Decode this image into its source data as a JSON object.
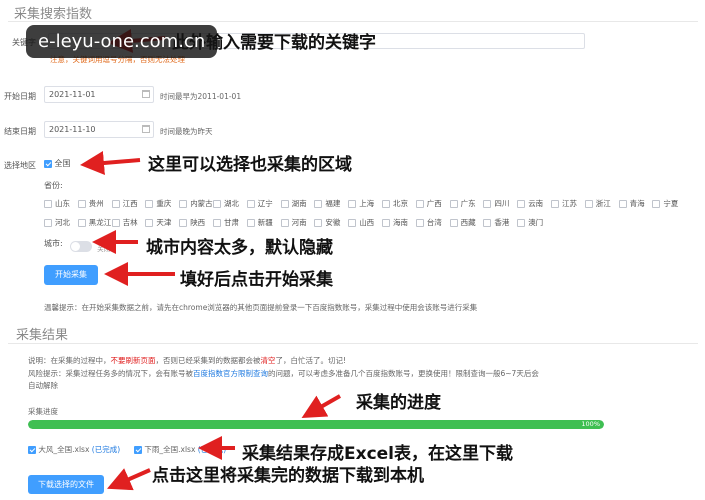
{
  "search_section": {
    "title": "采集搜索指数",
    "keyword_label": "关键字",
    "keyword_hint": "注意，关键词用逗号分隔，否则无法处理",
    "start_date": {
      "label": "开始日期",
      "value": "2021-11-01",
      "hint": "时间最早为2011-01-01"
    },
    "end_date": {
      "label": "结束日期",
      "value": "2021-11-10",
      "hint": "时间最晚为昨天"
    },
    "region_label": "选择地区",
    "nationwide_label": "全国",
    "province_label": "省份:",
    "provinces_row1": [
      "山东",
      "贵州",
      "江西",
      "重庆",
      "内蒙古",
      "湖北",
      "辽宁",
      "湖南",
      "福建",
      "上海",
      "北京",
      "广西",
      "广东",
      "四川",
      "云南",
      "江苏",
      "浙江",
      "青海",
      "宁夏"
    ],
    "provinces_row2": [
      "河北",
      "黑龙江",
      "吉林",
      "天津",
      "陕西",
      "甘肃",
      "新疆",
      "河南",
      "安徽",
      "山西",
      "海南",
      "台湾",
      "西藏",
      "香港",
      "澳门"
    ],
    "city_label": "城市:",
    "city_toggle_text": "关闭",
    "start_button": "开始采集",
    "tip": "温馨提示：在开始采集数据之前，请先在chrome浏览器的其他页面提前登录一下百度指数账号，采集过程中使用会该账号进行采集"
  },
  "result_section": {
    "title": "采集结果",
    "notice1_prefix": "说明：在采集的过程中，",
    "notice1_red": "不要刷新页面",
    "notice1_mid": "，否则已经采集到的数据都会被",
    "notice1_red2": "清空",
    "notice1_suffix": "了，白忙活了。切记!",
    "notice2_prefix": "风险提示：采集过程任务多的情况下，会有账号被",
    "notice2_link": "百度指数官方限制查询",
    "notice2_suffix": "的问题，可以考虑多准备几个百度指数账号，更换使用！限制查询一般6~7天后会",
    "notice2_line2": "自动解除",
    "progress_label": "采集进度",
    "progress_percent": 100,
    "progress_text": "100%",
    "files": [
      {
        "name": "大风_全国.xlsx",
        "status": "(已完成)"
      },
      {
        "name": "下雨_全国.xlsx",
        "status": "(已完成)"
      }
    ],
    "download_button": "下载选择的文件"
  },
  "annotations": {
    "a1": "此外输入需要下载的关键字",
    "a2": "这里可以选择也采集的区域",
    "a3": "城市内容太多，默认隐藏",
    "a4": "填好后点击开始采集",
    "a5": "采集的进度",
    "a6": "采集结果存成Excel表，在这里下载",
    "a7": "点击这里将采集完的数据下载到本机"
  },
  "watermark": "e-leyu-one.com.cn",
  "colors": {
    "primary": "#409eff",
    "progress": "#3fbf52",
    "arrow": "#e02020",
    "warning": "#e02020"
  }
}
